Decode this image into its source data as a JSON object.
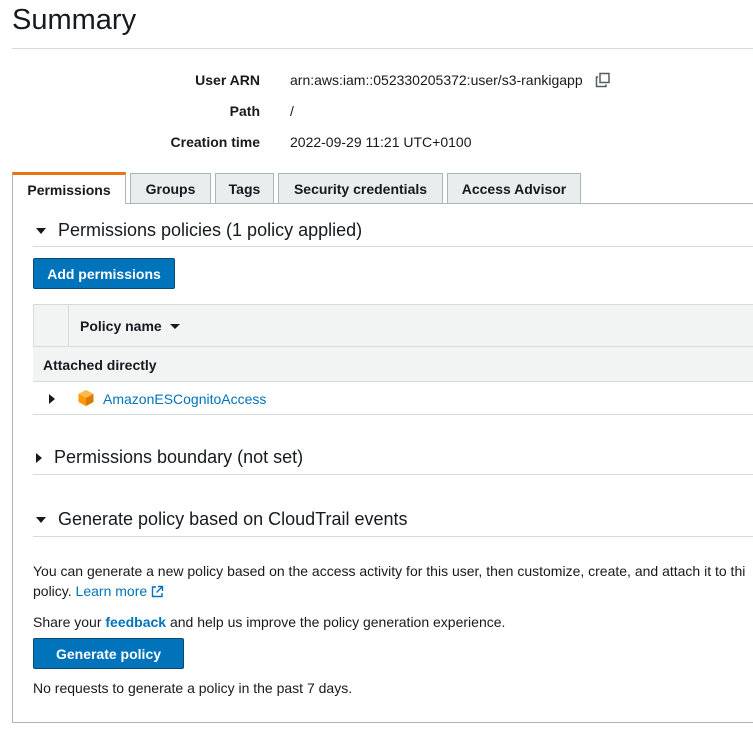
{
  "header": {
    "title": "Summary"
  },
  "summary": {
    "user_arn_label": "User ARN",
    "user_arn_value": "arn:aws:iam::052330205372:user/s3-rankigapp",
    "path_label": "Path",
    "path_value": "/",
    "creation_time_label": "Creation time",
    "creation_time_value": "2022-09-29 11:21 UTC+0100"
  },
  "tabs": [
    {
      "label": "Permissions",
      "active": true
    },
    {
      "label": "Groups"
    },
    {
      "label": "Tags"
    },
    {
      "label": "Security credentials"
    },
    {
      "label": "Access Advisor"
    }
  ],
  "permissions_policies": {
    "title": "Permissions policies (1 policy applied)",
    "add_button_label": "Add permissions",
    "table": {
      "column_header": "Policy name",
      "group_label": "Attached directly",
      "rows": [
        {
          "policy_name": "AmazonESCognitoAccess"
        }
      ]
    }
  },
  "permissions_boundary": {
    "title": "Permissions boundary (not set)"
  },
  "generate_policy": {
    "title": "Generate policy based on CloudTrail events",
    "description_line1": "You can generate a new policy based on the access activity for this user, then customize, create, and attach it to thi",
    "description_line2_prefix": "policy.",
    "learn_more_label": "Learn more",
    "feedback_prefix": "Share your",
    "feedback_link": "feedback",
    "feedback_suffix": "and help us improve the policy generation experience.",
    "button_label": "Generate policy",
    "status_text": "No requests to generate a policy in the past 7 days."
  },
  "colors": {
    "primary_button": "#0073bb",
    "link": "#0073bb",
    "active_tab_accent": "#ec7211",
    "policy_icon": "#f90"
  },
  "icons": {
    "copy": "copy-icon",
    "policy": "aws-managed-policy-icon",
    "external_link": "external-link-icon"
  }
}
